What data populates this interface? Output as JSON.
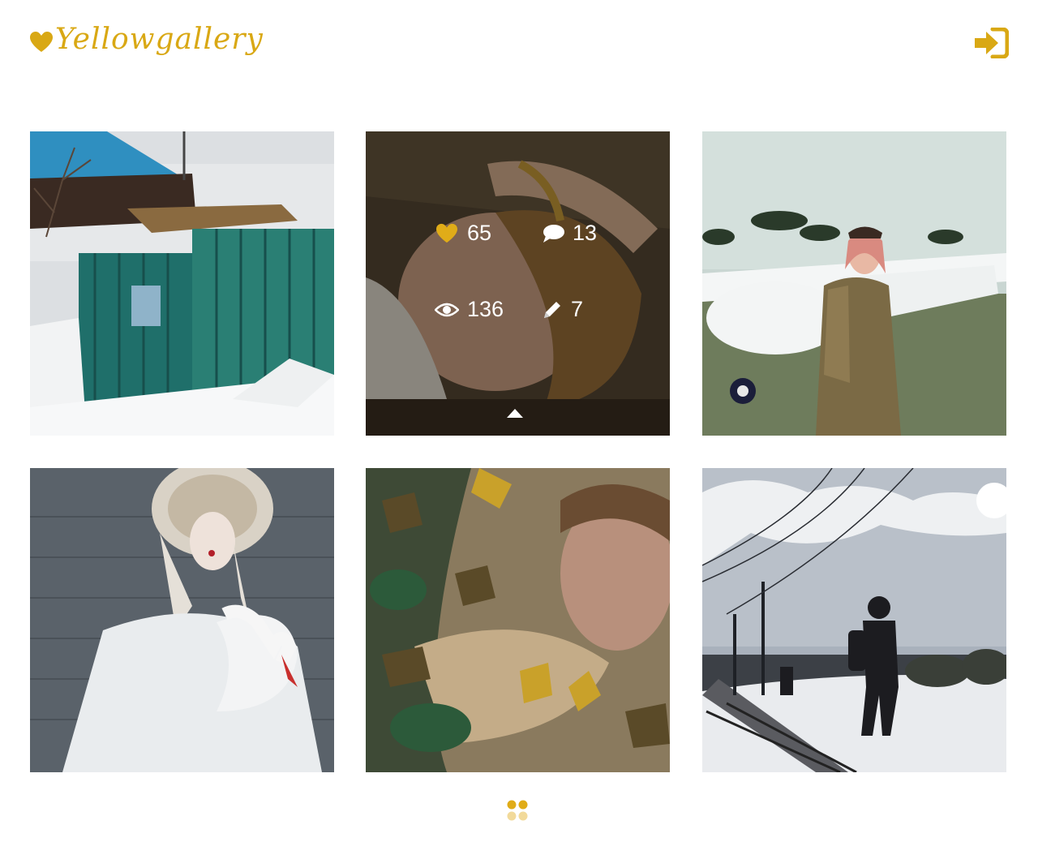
{
  "app": {
    "logo_text": "Yellowgallery",
    "accent_color": "#d9a814",
    "login_icon": "sign-in-icon"
  },
  "gallery": {
    "items": [
      {
        "subject": "winter wooden shed with green fence"
      },
      {
        "subject": "woman lying with braided hair",
        "hovered": true,
        "stats": {
          "likes": "65",
          "comments": "13",
          "views": "136",
          "edits": "7"
        }
      },
      {
        "subject": "woman in aviator outfit with small plane"
      },
      {
        "subject": "woman in kokoshnik holding swan"
      },
      {
        "subject": "man in water with autumn leaves"
      },
      {
        "subject": "silhouette of man walking on railway"
      }
    ]
  },
  "pager": {
    "icon": "grid-dots-icon"
  }
}
